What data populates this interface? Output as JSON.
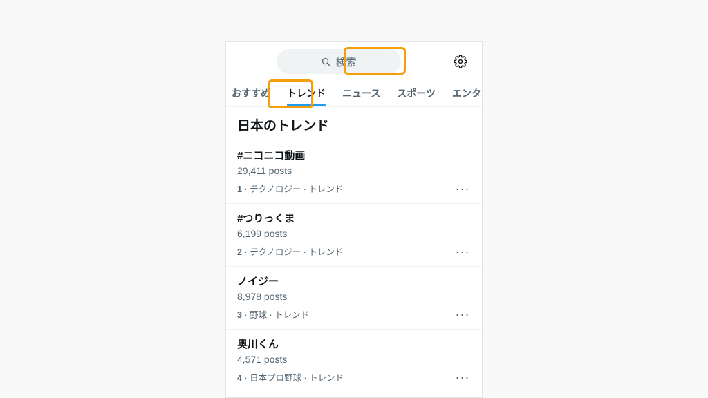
{
  "search": {
    "placeholder": "検索"
  },
  "tabs": [
    {
      "label": "おすすめ",
      "active": false
    },
    {
      "label": "トレンド",
      "active": true
    },
    {
      "label": "ニュース",
      "active": false
    },
    {
      "label": "スポーツ",
      "active": false
    },
    {
      "label": "エンターテイ",
      "active": false
    }
  ],
  "section_title": "日本のトレンド",
  "trends": [
    {
      "rank": "1",
      "name": "#ニコニコ動画",
      "count": "29,411 posts",
      "meta": "テクノロジー · トレンド"
    },
    {
      "rank": "2",
      "name": "#つりっくま",
      "count": "6,199 posts",
      "meta": "テクノロジー · トレンド"
    },
    {
      "rank": "3",
      "name": "ノイジー",
      "count": "8,978 posts",
      "meta": "野球 · トレンド"
    },
    {
      "rank": "4",
      "name": "奥川くん",
      "count": "4,571 posts",
      "meta": "日本プロ野球 · トレンド"
    }
  ],
  "highlight": {
    "accent": "#f59e0b"
  }
}
